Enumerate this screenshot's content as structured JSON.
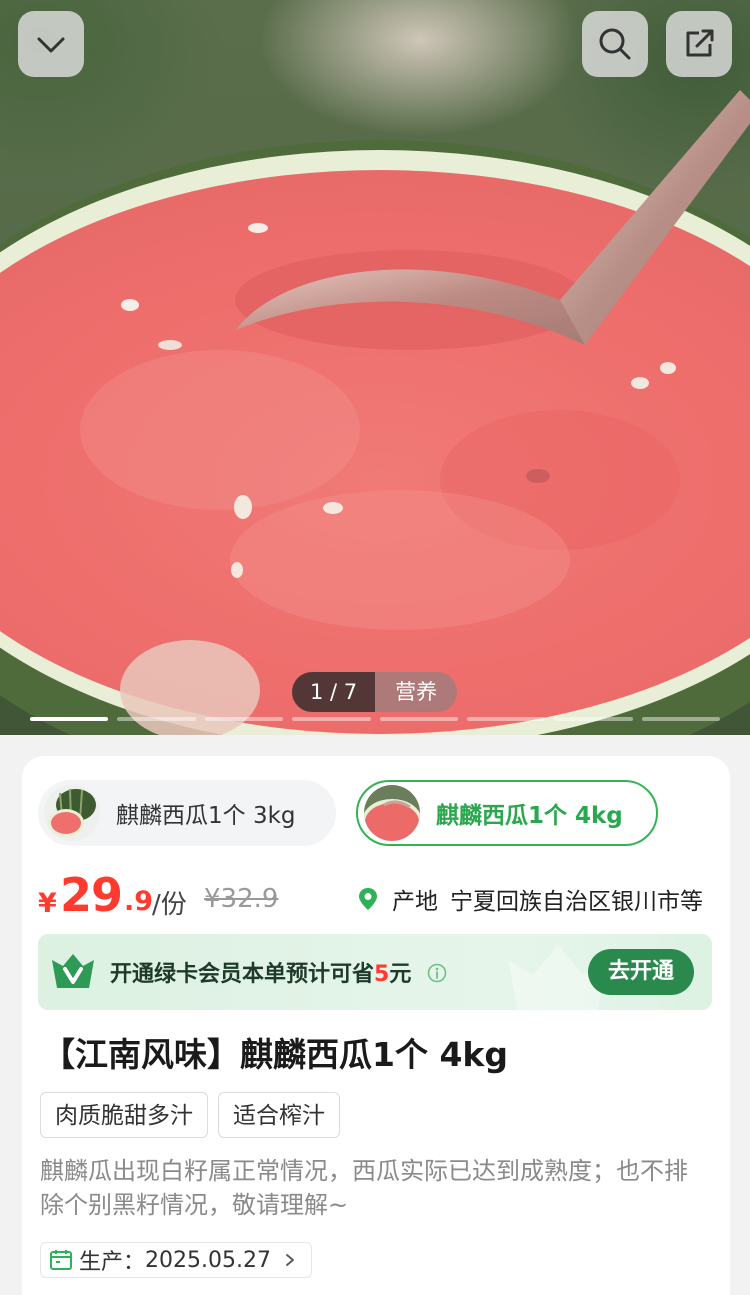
{
  "hero": {
    "indicator_count": "1 / 7",
    "indicator_tab": "营养",
    "segment_count": 8,
    "active_segment": 1
  },
  "icons": {
    "back": "chevron-down-icon",
    "search": "search-icon",
    "share": "share-icon",
    "location": "location-pin-icon",
    "member": "green-card-v-icon",
    "info": "info-icon",
    "calendar": "calendar-icon",
    "chevron": "chevron-right-icon"
  },
  "variants": [
    {
      "label": "麒麟西瓜1个 3kg",
      "selected": false
    },
    {
      "label": "麒麟西瓜1个 4kg",
      "selected": true
    }
  ],
  "price": {
    "symbol": "¥",
    "integer": "29",
    "decimal": ".9",
    "unit": "/份",
    "original": "¥32.9"
  },
  "origin": {
    "label": "产地",
    "value": "宁夏回族自治区银川市等"
  },
  "member": {
    "text_prefix": "开通绿卡会员本单预计可省",
    "amount": "5",
    "text_suffix": "元",
    "button": "去开通"
  },
  "product": {
    "title": "【江南风味】麒麟西瓜1个 4kg",
    "tags": [
      "肉质脆甜多汁",
      "适合榨汁"
    ],
    "description": "麒麟瓜出现白籽属正常情况，西瓜实际已达到成熟度；也不排除个别黑籽情况，敬请理解~",
    "production_label": "生产：",
    "production_date": "2025.05.27"
  },
  "colors": {
    "price_red": "#ff3a2f",
    "brand_green": "#2a8a4d",
    "selected_green": "#34b355"
  }
}
